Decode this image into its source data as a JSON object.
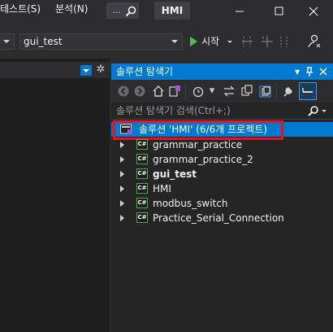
{
  "menu": {
    "items": [
      {
        "label": "테스트(S)"
      },
      {
        "label": "분석(N)"
      }
    ],
    "search_hint": "...",
    "app_title": "HMI"
  },
  "toolbar": {
    "config_value": "",
    "project_value": "gui_test",
    "start_label": "시작"
  },
  "solution_explorer": {
    "title": "솔루션 탐색기",
    "search_placeholder": "솔루션 탐색기 검색(Ctrl+;)",
    "solution_label": "솔루션 'HMI' (6/6개 프로젝트)",
    "projects": [
      {
        "name": "grammar_practice",
        "bold": false
      },
      {
        "name": "grammar_practice_2",
        "bold": false
      },
      {
        "name": "gui_test",
        "bold": true
      },
      {
        "name": "HMI",
        "bold": false
      },
      {
        "name": "modbus_switch",
        "bold": false
      },
      {
        "name": "Practice_Serial_Connection",
        "bold": false
      }
    ],
    "project_icon_text": "C#"
  },
  "colors": {
    "accent": "#007acc",
    "highlight_outline": "#e81123",
    "background": "#2d2d30",
    "panel": "#252526",
    "run_green": "#4fc04f"
  }
}
